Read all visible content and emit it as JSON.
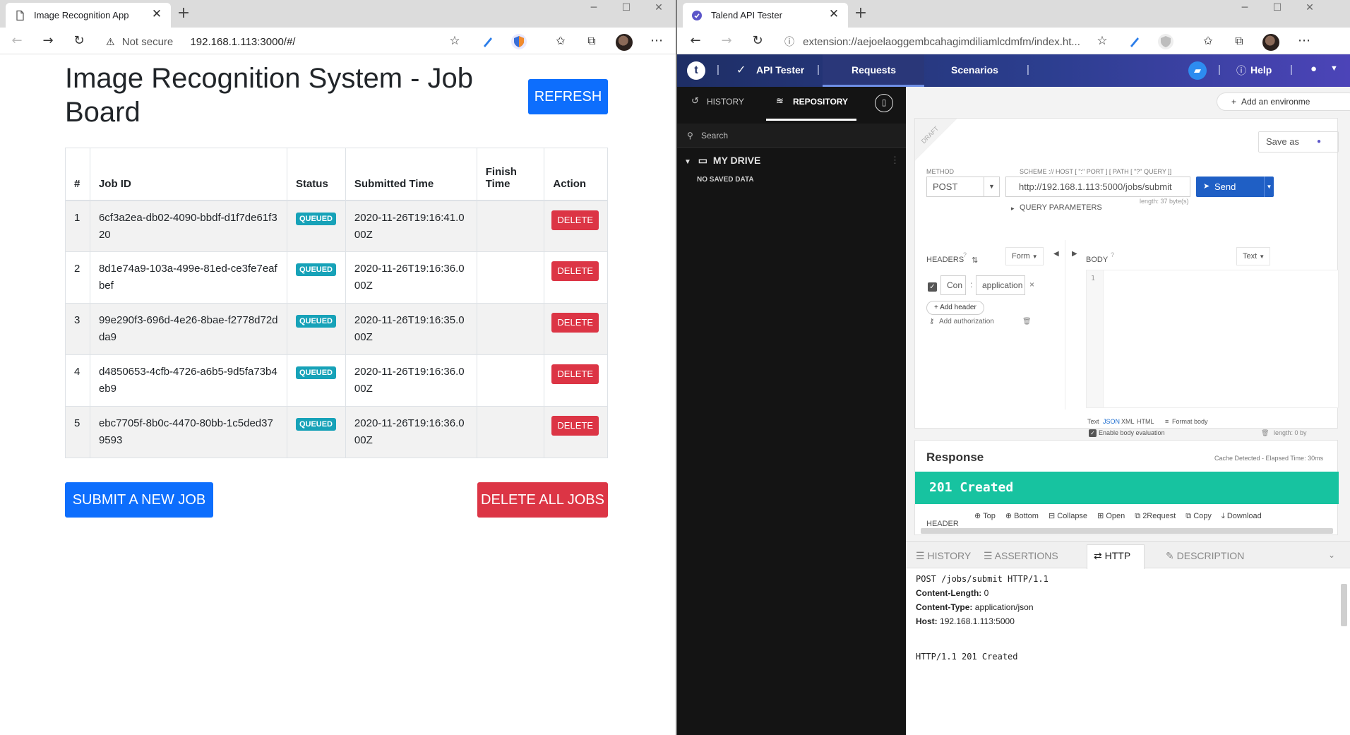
{
  "left_window": {
    "tab_title": "Image Recognition App",
    "url_security": "Not secure",
    "url": "192.168.1.113:3000/#/",
    "app": {
      "title": "Image Recognition System - Job Board",
      "refresh_label": "REFRESH",
      "columns": [
        "#",
        "Job ID",
        "Status",
        "Submitted Time",
        "Finish Time",
        "Action"
      ],
      "rows": [
        {
          "num": "1",
          "job_id": "6cf3a2ea-db02-4090-bbdf-d1f7de61f320",
          "status": "QUEUED",
          "submitted": "2020-11-26T19:16:41.000Z",
          "finish": "",
          "action": "DELETE"
        },
        {
          "num": "2",
          "job_id": "8d1e74a9-103a-499e-81ed-ce3fe7eafbef",
          "status": "QUEUED",
          "submitted": "2020-11-26T19:16:36.000Z",
          "finish": "",
          "action": "DELETE"
        },
        {
          "num": "3",
          "job_id": "99e290f3-696d-4e26-8bae-f2778d72dda9",
          "status": "QUEUED",
          "submitted": "2020-11-26T19:16:35.000Z",
          "finish": "",
          "action": "DELETE"
        },
        {
          "num": "4",
          "job_id": "d4850653-4cfb-4726-a6b5-9d5fa73b4eb9",
          "status": "QUEUED",
          "submitted": "2020-11-26T19:16:36.000Z",
          "finish": "",
          "action": "DELETE"
        },
        {
          "num": "5",
          "job_id": "ebc7705f-8b0c-4470-80bb-1c5ded379593",
          "status": "QUEUED",
          "submitted": "2020-11-26T19:16:36.000Z",
          "finish": "",
          "action": "DELETE"
        }
      ],
      "submit_label": "SUBMIT A NEW JOB",
      "delete_all_label": "DELETE ALL JOBS"
    }
  },
  "right_window": {
    "tab_title": "Talend API Tester",
    "url": "extension://aejoelaoggembcahagimdiliamlcdmfm/index.ht...",
    "topbar": {
      "logo": "t",
      "app_name": "API Tester",
      "requests": "Requests",
      "scenarios": "Scenarios",
      "help": "Help"
    },
    "sidebar": {
      "history": "HISTORY",
      "repository": "REPOSITORY",
      "search_placeholder": "Search",
      "drive": "MY DRIVE",
      "no_data": "NO SAVED DATA"
    },
    "request": {
      "add_environment": "Add an environme",
      "draft": "DRAFT",
      "save_as": "Save as",
      "method_label": "METHOD",
      "method": "POST",
      "scheme_label": "SCHEME :// HOST [ \":\" PORT ] [ PATH [ \"?\" QUERY ]]",
      "url": "http://192.168.1.113:5000/jobs/submit",
      "send": "Send",
      "length": "length: 37 byte(s)",
      "query_params": "QUERY PARAMETERS",
      "headers_label": "HEADERS",
      "form": "Form",
      "body_label": "BODY",
      "body_type": "Text",
      "header_name": "Con",
      "header_value": "application",
      "add_header": "Add header",
      "add_auth": "Add authorization",
      "body_line": "1",
      "body_formats": [
        "Text",
        "JSON",
        "XML",
        "HTML"
      ],
      "format_body": "Format body",
      "enable_eval": "Enable body evaluation",
      "body_length": "length: 0 by"
    },
    "response": {
      "title": "Response",
      "elapsed": "Cache Detected - Elapsed Time: 30ms",
      "status": "201 Created",
      "header_label": "HEADER",
      "actions": [
        "Top",
        "Bottom",
        "Collapse",
        "Open",
        "2Request",
        "Copy",
        "Download"
      ]
    },
    "bottom": {
      "tabs": [
        "HISTORY",
        "ASSERTIONS",
        "HTTP",
        "DESCRIPTION"
      ],
      "request_line": "POST /jobs/submit HTTP/1.1",
      "h1_name": "Content-Length:",
      "h1_value": "0",
      "h2_name": "Content-Type:",
      "h2_value": "application/json",
      "h3_name": "Host:",
      "h3_value": "192.168.1.113:5000",
      "response_line": "HTTP/1.1 201 Created"
    }
  },
  "colors": {
    "primary": "#0d6efd",
    "danger": "#dc3545",
    "info_badge": "#17a2b8",
    "status_ok": "#17c3a0",
    "talend_nav": "#2c3e8f"
  }
}
